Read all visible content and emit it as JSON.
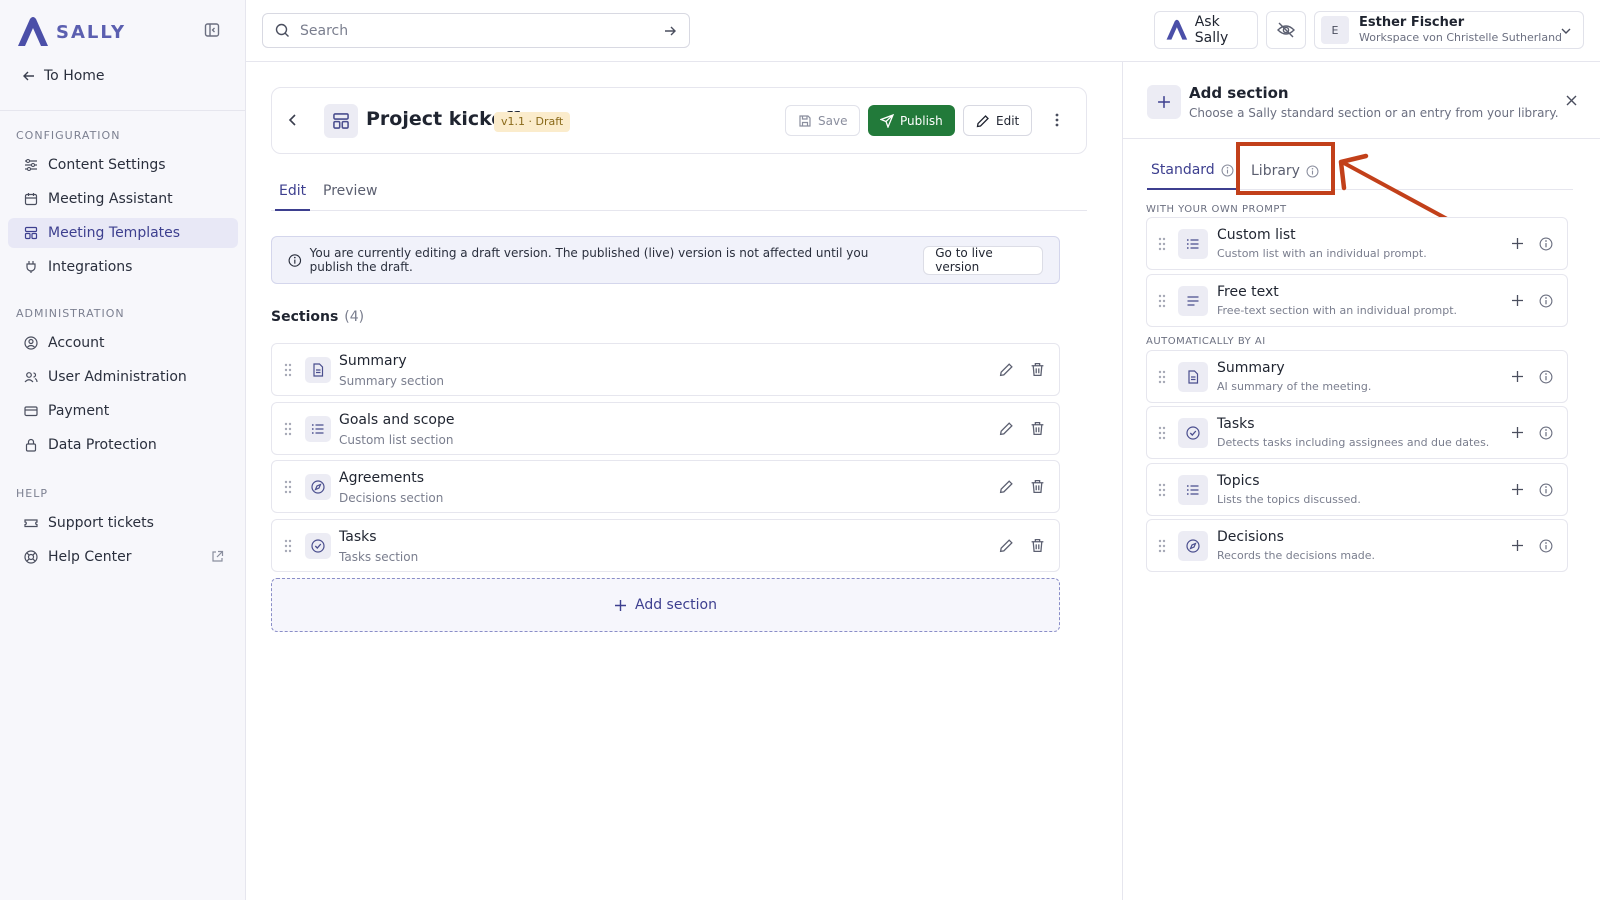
{
  "brand": {
    "name": "SALLY"
  },
  "sidebar": {
    "to_home": "To Home",
    "groups": [
      {
        "title": "CONFIGURATION",
        "items": [
          {
            "label": "Content Settings",
            "icon": "sliders-icon"
          },
          {
            "label": "Meeting Assistant",
            "icon": "calendar-icon"
          },
          {
            "label": "Meeting Templates",
            "icon": "layout-icon",
            "active": true
          },
          {
            "label": "Integrations",
            "icon": "plug-icon"
          }
        ]
      },
      {
        "title": "ADMINISTRATION",
        "items": [
          {
            "label": "Account",
            "icon": "user-circle-icon"
          },
          {
            "label": "User Administration",
            "icon": "users-icon"
          },
          {
            "label": "Payment",
            "icon": "credit-card-icon"
          },
          {
            "label": "Data Protection",
            "icon": "lock-icon"
          }
        ]
      },
      {
        "title": "HELP",
        "items": [
          {
            "label": "Support tickets",
            "icon": "ticket-icon"
          },
          {
            "label": "Help Center",
            "icon": "lifebuoy-icon",
            "external": true
          }
        ]
      }
    ]
  },
  "topbar": {
    "search_placeholder": "Search",
    "ask_label": "Ask Sally",
    "user_name": "Esther Fischer",
    "user_initial": "E",
    "workspace": "Workspace von Christelle Sutherland"
  },
  "template": {
    "title": "Project kickoff",
    "badge": "v1.1 · Draft",
    "save_label": "Save",
    "publish_label": "Publish",
    "edit_label": "Edit"
  },
  "tabs": {
    "edit": "Edit",
    "preview": "Preview"
  },
  "info": {
    "text": "You are currently editing a draft version. The published (live) version is not affected until you publish the draft.",
    "button": "Go to live version"
  },
  "sections": {
    "title": "Sections",
    "count": "(4)",
    "items": [
      {
        "title": "Summary",
        "subtitle": "Summary section",
        "icon": "document-icon"
      },
      {
        "title": "Goals and scope",
        "subtitle": "Custom list section",
        "icon": "list-icon"
      },
      {
        "title": "Agreements",
        "subtitle": "Decisions section",
        "icon": "compass-icon"
      },
      {
        "title": "Tasks",
        "subtitle": "Tasks section",
        "icon": "check-circle-icon"
      }
    ],
    "add_label": "Add section"
  },
  "panel": {
    "title": "Add section",
    "subtitle": "Choose a Sally standard section or an entry from your library.",
    "tabs": {
      "standard": "Standard",
      "library": "Library"
    },
    "group_prompt": "WITH YOUR OWN PROMPT",
    "group_ai": "AUTOMATICALLY BY AI",
    "prompt_items": [
      {
        "title": "Custom list",
        "subtitle": "Custom list with an individual prompt.",
        "icon": "list-icon"
      },
      {
        "title": "Free text",
        "subtitle": "Free-text section with an individual prompt.",
        "icon": "text-lines-icon"
      }
    ],
    "ai_items": [
      {
        "title": "Summary",
        "subtitle": "AI summary of the meeting.",
        "icon": "document-icon"
      },
      {
        "title": "Tasks",
        "subtitle": "Detects tasks including assignees and due dates.",
        "icon": "check-circle-icon"
      },
      {
        "title": "Topics",
        "subtitle": "Lists the topics discussed.",
        "icon": "list-icon"
      },
      {
        "title": "Decisions",
        "subtitle": "Records the decisions made.",
        "icon": "compass-icon"
      }
    ]
  },
  "colors": {
    "accent": "#3d3f8f",
    "publish": "#227a3a",
    "highlight": "#c2401a"
  }
}
